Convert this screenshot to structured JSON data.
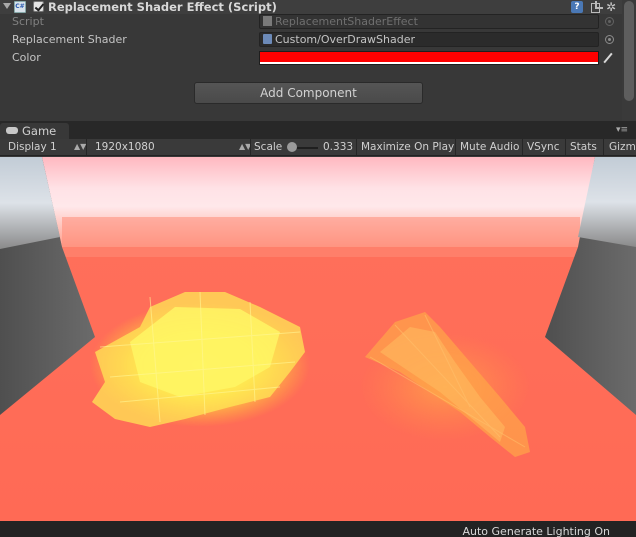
{
  "inspector": {
    "component_title": "Replacement Shader Effect (Script)",
    "help_icon": "?",
    "properties": {
      "script": {
        "label": "Script",
        "value": "ReplacementShaderEffect"
      },
      "replacement_shader": {
        "label": "Replacement Shader",
        "value": "Custom/OverDrawShader"
      },
      "color": {
        "label": "Color",
        "value_hex": "#ff0000"
      }
    },
    "add_component_label": "Add Component"
  },
  "game_view": {
    "tab_label": "Game",
    "toolbar": {
      "display": "Display 1",
      "resolution": "1920x1080",
      "scale_label": "Scale",
      "scale_value": "0.333",
      "maximize_on_play": "Maximize On Play",
      "mute_audio": "Mute Audio",
      "vsync": "VSync",
      "stats": "Stats",
      "gizmos": "Gizmos"
    },
    "overlay_color": "#ff6f5a"
  },
  "status_bar": {
    "text": "Auto Generate Lighting On"
  }
}
